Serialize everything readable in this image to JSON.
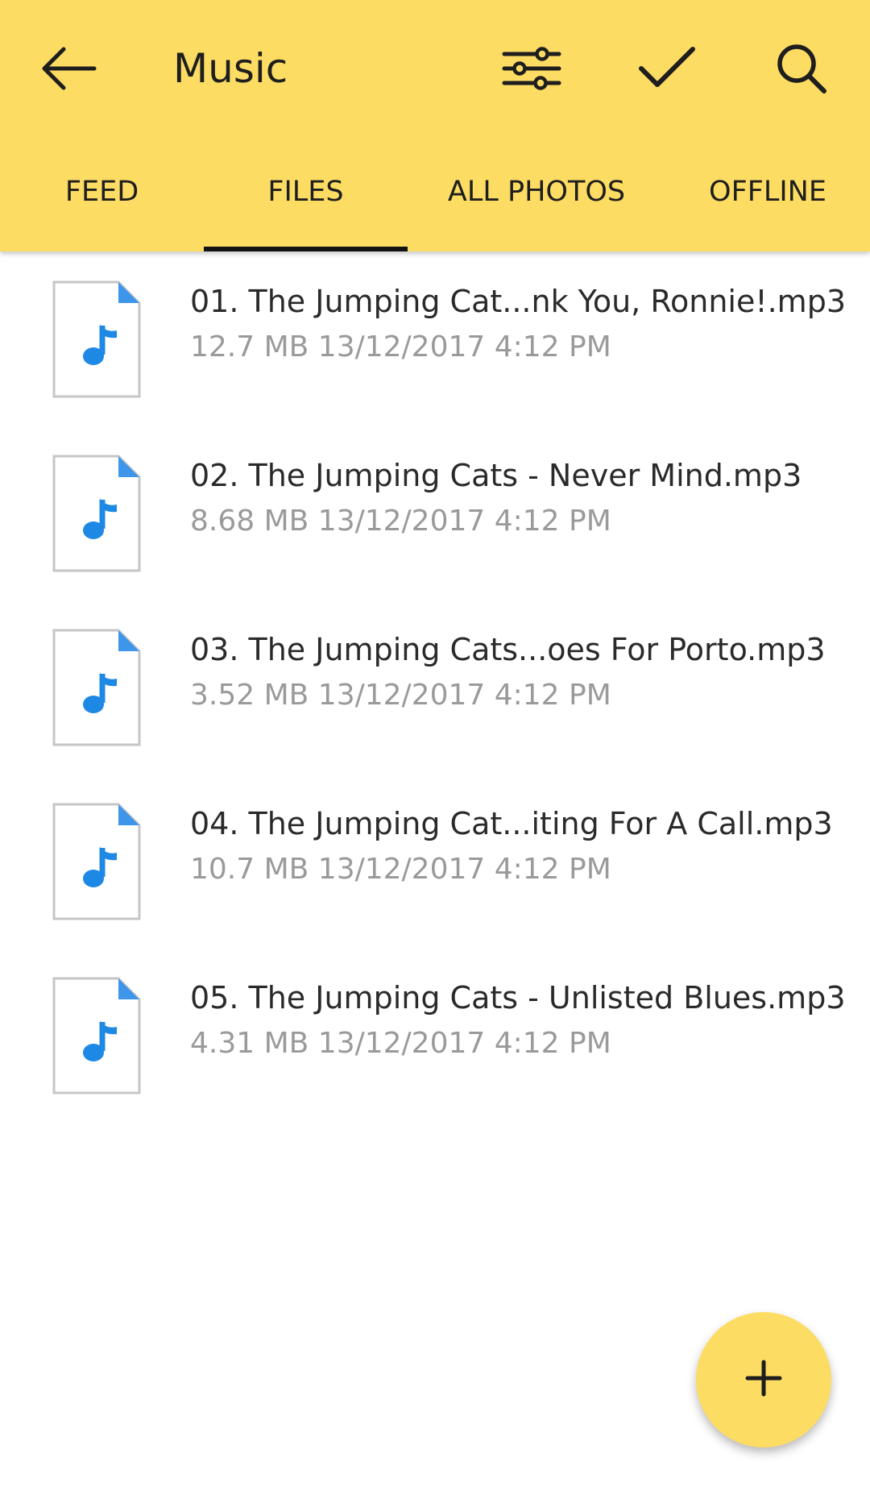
{
  "colors": {
    "appbar": "#FDDC63",
    "fab": "#FDDC63",
    "tab_indicator": "#111111",
    "file_icon_accent": "#1E88E5",
    "meta_text": "#9A9A9A"
  },
  "toolbar": {
    "title": "Music",
    "back_icon": "arrow-left-icon",
    "filter_icon": "sliders-icon",
    "select_icon": "checkmark-icon",
    "search_icon": "search-icon"
  },
  "tabs": [
    {
      "label": "FEED",
      "selected": false
    },
    {
      "label": "FILES",
      "selected": true
    },
    {
      "label": "ALL PHOTOS",
      "selected": false
    },
    {
      "label": "OFFLINE",
      "selected": false
    }
  ],
  "files": [
    {
      "name": "01. The Jumping Cat...nk You, Ronnie!.mp3",
      "meta": "12.7 MB 13/12/2017 4:12 PM",
      "icon": "music-file-icon"
    },
    {
      "name": "02. The Jumping Cats - Never Mind.mp3",
      "meta": "8.68 MB 13/12/2017 4:12 PM",
      "icon": "music-file-icon"
    },
    {
      "name": "03. The Jumping Cats...oes For Porto.mp3",
      "meta": "3.52 MB 13/12/2017 4:12 PM",
      "icon": "music-file-icon"
    },
    {
      "name": "04. The Jumping Cat...iting For A Call.mp3",
      "meta": "10.7 MB 13/12/2017 4:12 PM",
      "icon": "music-file-icon"
    },
    {
      "name": "05. The Jumping Cats - Unlisted Blues.mp3",
      "meta": "4.31 MB 13/12/2017 4:12 PM",
      "icon": "music-file-icon"
    }
  ],
  "fab": {
    "icon": "plus-icon"
  }
}
